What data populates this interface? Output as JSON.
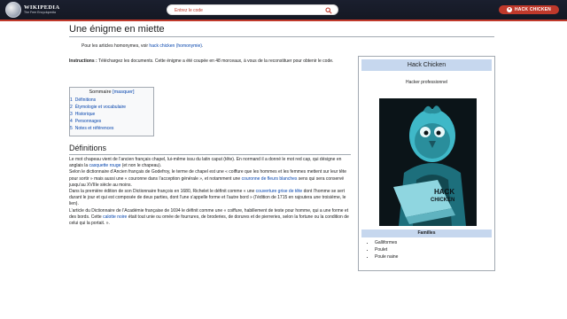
{
  "header": {
    "logo_name": "WIKIPEDIA",
    "logo_sub": "The Free Encyclopedia",
    "search_placeholder": "Entrez le code",
    "hack_button_label": "HACK CHICKEN",
    "accent_color": "#c0392b"
  },
  "article": {
    "title": "Une énigme en miette",
    "hatnote_prefix": "Pour les articles homonymes, voir ",
    "hatnote_link": "hack chicken (homonymie)",
    "hatnote_suffix": ".",
    "instructions_label": "Instructions :",
    "instructions_text": " Téléchargez les documents. Cette énigme a été coupée en 48 morceaux, à vous de la reconstituer pour obtenir le code."
  },
  "toc": {
    "title": "Sommaire",
    "toggle": "[masquer]",
    "items": [
      {
        "num": "1",
        "label": "Définitions"
      },
      {
        "num": "2",
        "label": "Étymologie et vocabulaire"
      },
      {
        "num": "3",
        "label": "Historique"
      },
      {
        "num": "4",
        "label": "Personnages"
      },
      {
        "num": "5",
        "label": "Notes et références"
      }
    ]
  },
  "section": {
    "heading": "Définitions",
    "p1a": "Le mot chapeau vient de l’ancien français chapel, lui-même issu du latin caput (tête). En normand il a donné le mot red cap, qui désigne en anglais la ",
    "p1_link": "casquette rouge",
    "p1b": " (et non le chapeau).",
    "p2a": "Selon le dictionnaire d’Ancien français de Godefroy, le terme de chapel est une « coiffure que les hommes et les femmes mettent sur leur tête pour sortir » mais aussi une « couronne dans l’acception générale », et notamment une ",
    "p2_link": "couronne de fleurs blanches",
    "p2b": " sens qui sera conservé jusqu’au XVIIIe siècle au moins.",
    "p3a": "Dans la première édition de son Dictionnaire françois en 1680, Richelet le définit comme « une ",
    "p3_link": "couverture grise de tête",
    "p3b": " dont l’homme se sert durant le jour et qui est composée de deux parties, dont l’une s’appelle forme et l’autre bord » (l’édition de 1715 en rajoutera une troisième, le lien).",
    "p4a": "L’article du Dictionnaire de l’Académie française de 1694 le définit comme une « coiffure, habillement de teste pour homme, qui a une forme et des bords. Cette ",
    "p4_link": "calotte noire",
    "p4b": " était tout unie ou ornée de fourrures, de broderies, de dorures et de pierreries, selon la fortune ou la condition de celui qui la portait. »."
  },
  "infobox": {
    "title": "Hack Chicken",
    "subtitle": "Hacker professionnel",
    "image_text_line1": "HACK",
    "image_text_line2": "CHICKEN",
    "section_title": "Familles",
    "families": [
      "Galliformes",
      "Poulet",
      "Poule naine"
    ],
    "header_color": "#c6d7ee"
  }
}
